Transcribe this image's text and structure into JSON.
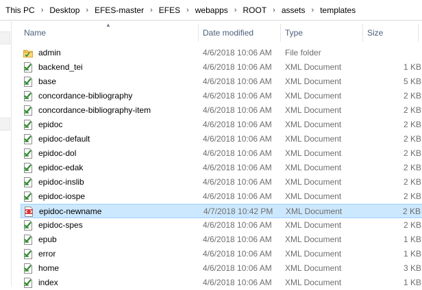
{
  "breadcrumb": [
    "This PC",
    "Desktop",
    "EFES-master",
    "EFES",
    "webapps",
    "ROOT",
    "assets",
    "templates"
  ],
  "columns": {
    "name": "Name",
    "date": "Date modified",
    "type": "Type",
    "size": "Size"
  },
  "sort": {
    "column": "name",
    "direction": "ascending"
  },
  "colors": {
    "selection": "#cce8ff",
    "selection_border": "#99d1ff",
    "header_text": "#4c607a",
    "detail_text": "#6d6d6d"
  },
  "files": [
    {
      "name": "admin",
      "date": "4/6/2018 10:06 AM",
      "type": "File folder",
      "size": "",
      "icon": "folder-icon",
      "selected": false
    },
    {
      "name": "backend_tei",
      "date": "4/6/2018 10:06 AM",
      "type": "XML Document",
      "size": "1 KB",
      "icon": "xml-file-icon",
      "selected": false
    },
    {
      "name": "base",
      "date": "4/6/2018 10:06 AM",
      "type": "XML Document",
      "size": "5 KB",
      "icon": "xml-file-icon",
      "selected": false
    },
    {
      "name": "concordance-bibliography",
      "date": "4/6/2018 10:06 AM",
      "type": "XML Document",
      "size": "2 KB",
      "icon": "xml-file-icon",
      "selected": false
    },
    {
      "name": "concordance-bibliography-item",
      "date": "4/6/2018 10:06 AM",
      "type": "XML Document",
      "size": "2 KB",
      "icon": "xml-file-icon",
      "selected": false
    },
    {
      "name": "epidoc",
      "date": "4/6/2018 10:06 AM",
      "type": "XML Document",
      "size": "2 KB",
      "icon": "xml-file-icon",
      "selected": false
    },
    {
      "name": "epidoc-default",
      "date": "4/6/2018 10:06 AM",
      "type": "XML Document",
      "size": "2 KB",
      "icon": "xml-file-icon",
      "selected": false
    },
    {
      "name": "epidoc-dol",
      "date": "4/6/2018 10:06 AM",
      "type": "XML Document",
      "size": "2 KB",
      "icon": "xml-file-icon",
      "selected": false
    },
    {
      "name": "epidoc-edak",
      "date": "4/6/2018 10:06 AM",
      "type": "XML Document",
      "size": "2 KB",
      "icon": "xml-file-icon",
      "selected": false
    },
    {
      "name": "epidoc-inslib",
      "date": "4/6/2018 10:06 AM",
      "type": "XML Document",
      "size": "2 KB",
      "icon": "xml-file-icon",
      "selected": false
    },
    {
      "name": "epidoc-iospe",
      "date": "4/6/2018 10:06 AM",
      "type": "XML Document",
      "size": "2 KB",
      "icon": "xml-file-icon",
      "selected": false
    },
    {
      "name": "epidoc-newname",
      "date": "4/7/2018 10:42 PM",
      "type": "XML Document",
      "size": "2 KB",
      "icon": "xml-code-file-icon",
      "selected": true
    },
    {
      "name": "epidoc-spes",
      "date": "4/6/2018 10:06 AM",
      "type": "XML Document",
      "size": "2 KB",
      "icon": "xml-file-icon",
      "selected": false
    },
    {
      "name": "epub",
      "date": "4/6/2018 10:06 AM",
      "type": "XML Document",
      "size": "1 KB",
      "icon": "xml-file-icon",
      "selected": false
    },
    {
      "name": "error",
      "date": "4/6/2018 10:06 AM",
      "type": "XML Document",
      "size": "1 KB",
      "icon": "xml-file-icon",
      "selected": false
    },
    {
      "name": "home",
      "date": "4/6/2018 10:06 AM",
      "type": "XML Document",
      "size": "3 KB",
      "icon": "xml-file-icon",
      "selected": false
    },
    {
      "name": "index",
      "date": "4/6/2018 10:06 AM",
      "type": "XML Document",
      "size": "1 KB",
      "icon": "xml-file-icon",
      "selected": false
    }
  ]
}
